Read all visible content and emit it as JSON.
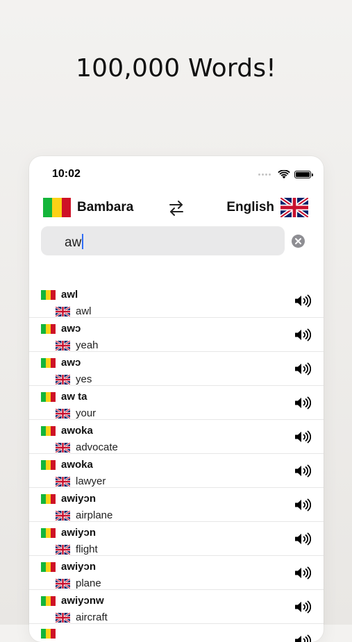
{
  "headline": "100,000 Words!",
  "status_bar": {
    "time": "10:02"
  },
  "languages": {
    "from": "Bambara",
    "to": "English"
  },
  "search": {
    "value": "aw"
  },
  "results": [
    {
      "bambara": "awl",
      "english": "awl"
    },
    {
      "bambara": "awɔ",
      "english": "yeah"
    },
    {
      "bambara": "awɔ",
      "english": "yes"
    },
    {
      "bambara": "aw ta",
      "english": "your"
    },
    {
      "bambara": "awoka",
      "english": "advocate"
    },
    {
      "bambara": "awoka",
      "english": "lawyer"
    },
    {
      "bambara": "awiyɔn",
      "english": "airplane"
    },
    {
      "bambara": "awiyɔn",
      "english": "flight"
    },
    {
      "bambara": "awiyɔn",
      "english": "plane"
    },
    {
      "bambara": "awiyɔnw",
      "english": "aircraft"
    },
    {
      "bambara": "",
      "english": ""
    }
  ],
  "icons": {
    "swap": "swap-arrows-icon",
    "clear": "clear-circle-icon",
    "speaker": "speaker-icon"
  },
  "colors": {
    "accent_caret": "#2f6df6"
  }
}
